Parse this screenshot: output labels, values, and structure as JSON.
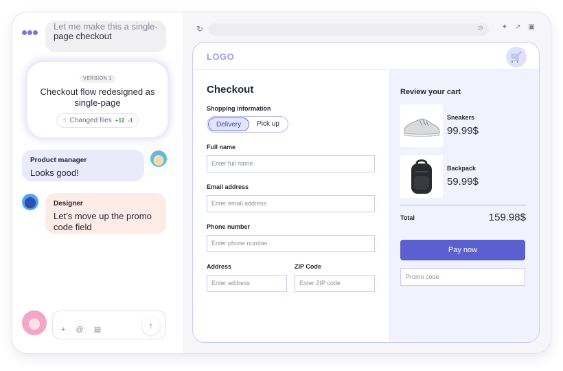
{
  "chat": {
    "bot_top": {
      "line1": "Let me make this a single-",
      "line2": "page checkout"
    },
    "version": {
      "badge": "VERSION 1",
      "title": "Checkout flow redesigned as single-page",
      "changed_files": "Changed files",
      "additions": "+12",
      "deletions": "-1"
    },
    "pm": {
      "sender": "Product manager",
      "text": "Looks good!"
    },
    "designer": {
      "sender": "Designer",
      "text": "Let’s move up the promo code field"
    },
    "composer": {
      "tools": [
        "+",
        "@",
        "▤"
      ],
      "send_icon": "arrow-up-icon"
    }
  },
  "browser": {
    "url": ""
  },
  "site": {
    "logo": "LOGO",
    "checkout_title": "Checkout",
    "shopping_info_label": "Shopping information",
    "options": [
      "Delivery",
      "Pick up"
    ],
    "selected_option": "Delivery",
    "fields": {
      "full_name": {
        "label": "Full name",
        "placeholder": "Enter full name"
      },
      "email": {
        "label": "Email address",
        "placeholder": "Enter email address"
      },
      "phone": {
        "label": "Phone number",
        "placeholder": "Enter phone number"
      },
      "address": {
        "label": "Address",
        "placeholder": "Enter address"
      },
      "zip": {
        "label": "ZIP Code",
        "placeholder": "Enter ZIP code"
      }
    },
    "review": {
      "title": "Review your cart",
      "items": [
        {
          "name": "Sneakers",
          "price": "99.99$"
        },
        {
          "name": "Backpack",
          "price": "59.99$"
        }
      ],
      "total_label": "Total",
      "total_value": "159.98$",
      "pay_label": "Pay now",
      "promo_placeholder": "Promo code"
    }
  },
  "colors": {
    "accent": "#5c5fcf",
    "brand_light": "#dfe1fb",
    "success": "#2e9b5a",
    "danger": "#d64545"
  }
}
